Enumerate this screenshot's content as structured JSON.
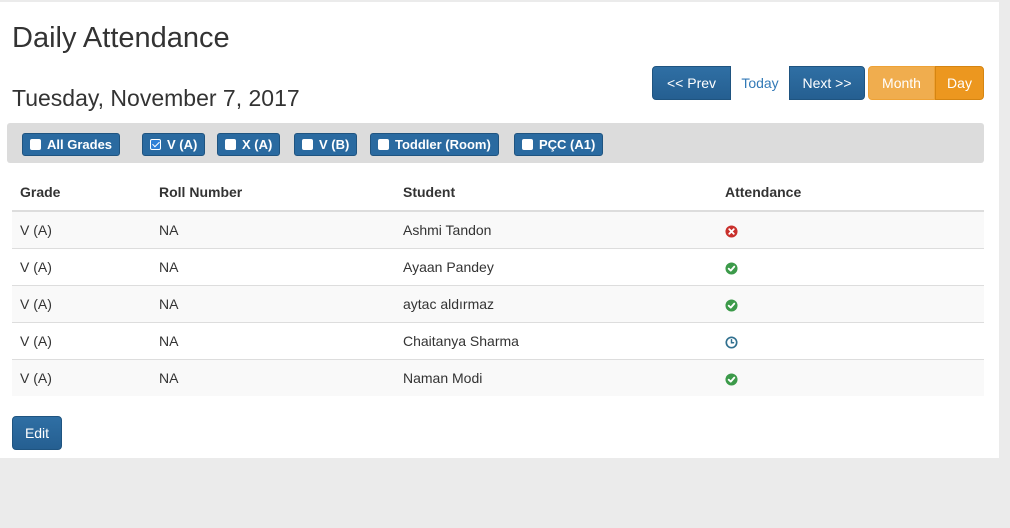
{
  "page": {
    "title": "Daily Attendance",
    "date": "Tuesday, November 7, 2017"
  },
  "nav": {
    "prev": "<< Prev",
    "today": "Today",
    "next": "Next >>",
    "month": "Month",
    "day": "Day"
  },
  "filters": [
    {
      "label": "All Grades",
      "checked": false
    },
    {
      "label": "V (A)",
      "checked": true
    },
    {
      "label": "X (A)",
      "checked": false
    },
    {
      "label": "V (B)",
      "checked": false
    },
    {
      "label": "Toddler (Room)",
      "checked": false
    },
    {
      "label": "PÇC (A1)",
      "checked": false
    }
  ],
  "table": {
    "headers": [
      "Grade",
      "Roll Number",
      "Student",
      "Attendance"
    ],
    "rows": [
      {
        "grade": "V (A)",
        "roll": "NA",
        "student": "Ashmi Tandon",
        "status": "absent-icon"
      },
      {
        "grade": "V (A)",
        "roll": "NA",
        "student": "Ayaan Pandey",
        "status": "present-icon"
      },
      {
        "grade": "V (A)",
        "roll": "NA",
        "student": "aytac aldırmaz",
        "status": "present-icon"
      },
      {
        "grade": "V (A)",
        "roll": "NA",
        "student": "Chaitanya Sharma",
        "status": "late-icon"
      },
      {
        "grade": "V (A)",
        "roll": "NA",
        "student": "Naman Modi",
        "status": "present-icon"
      }
    ]
  },
  "edit_label": "Edit",
  "colors": {
    "primary": "#2a6aa0",
    "warning": "#f0ad4e",
    "present": "#3c9a4a",
    "absent": "#c9302c",
    "late": "#31708f"
  }
}
